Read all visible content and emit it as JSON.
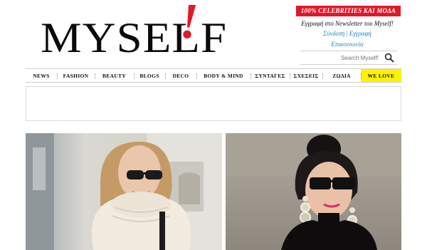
{
  "brand": {
    "logo_text": "MYSELF",
    "logo_mark": "!",
    "accent": "#e3172a",
    "link_color": "#1a86c8"
  },
  "header": {
    "promo": "100% CELEBRITIES ΚΑΙ ΜΟΔΑ",
    "newsletter": "Εγγραφή στο Newsletter του Myself!",
    "login": "Σύνδεση",
    "register": "Εγγραφή",
    "contact": "Επικοινωνία"
  },
  "search": {
    "placeholder": "Search Myself!",
    "icon": "search-icon"
  },
  "nav": {
    "items": [
      {
        "label": "NEWS"
      },
      {
        "label": "FASHION"
      },
      {
        "label": "BEAUTY"
      },
      {
        "label": "BLOGS"
      },
      {
        "label": "DECO"
      },
      {
        "label": "BODY & MIND"
      },
      {
        "label": "ΣΥΝΤΑΓΕΣ"
      },
      {
        "label": "ΣΧΕΣΕΙΣ"
      },
      {
        "label": "ΖΩΔΙΑ"
      },
      {
        "label": "WE LOVE"
      }
    ],
    "highlight_color": "#fff200"
  },
  "content": {
    "photos": [
      {
        "subject": "blonde woman in cream turtleneck and sunglasses"
      },
      {
        "subject": "dark-haired woman in black sunglasses with pink lipstick"
      }
    ]
  }
}
